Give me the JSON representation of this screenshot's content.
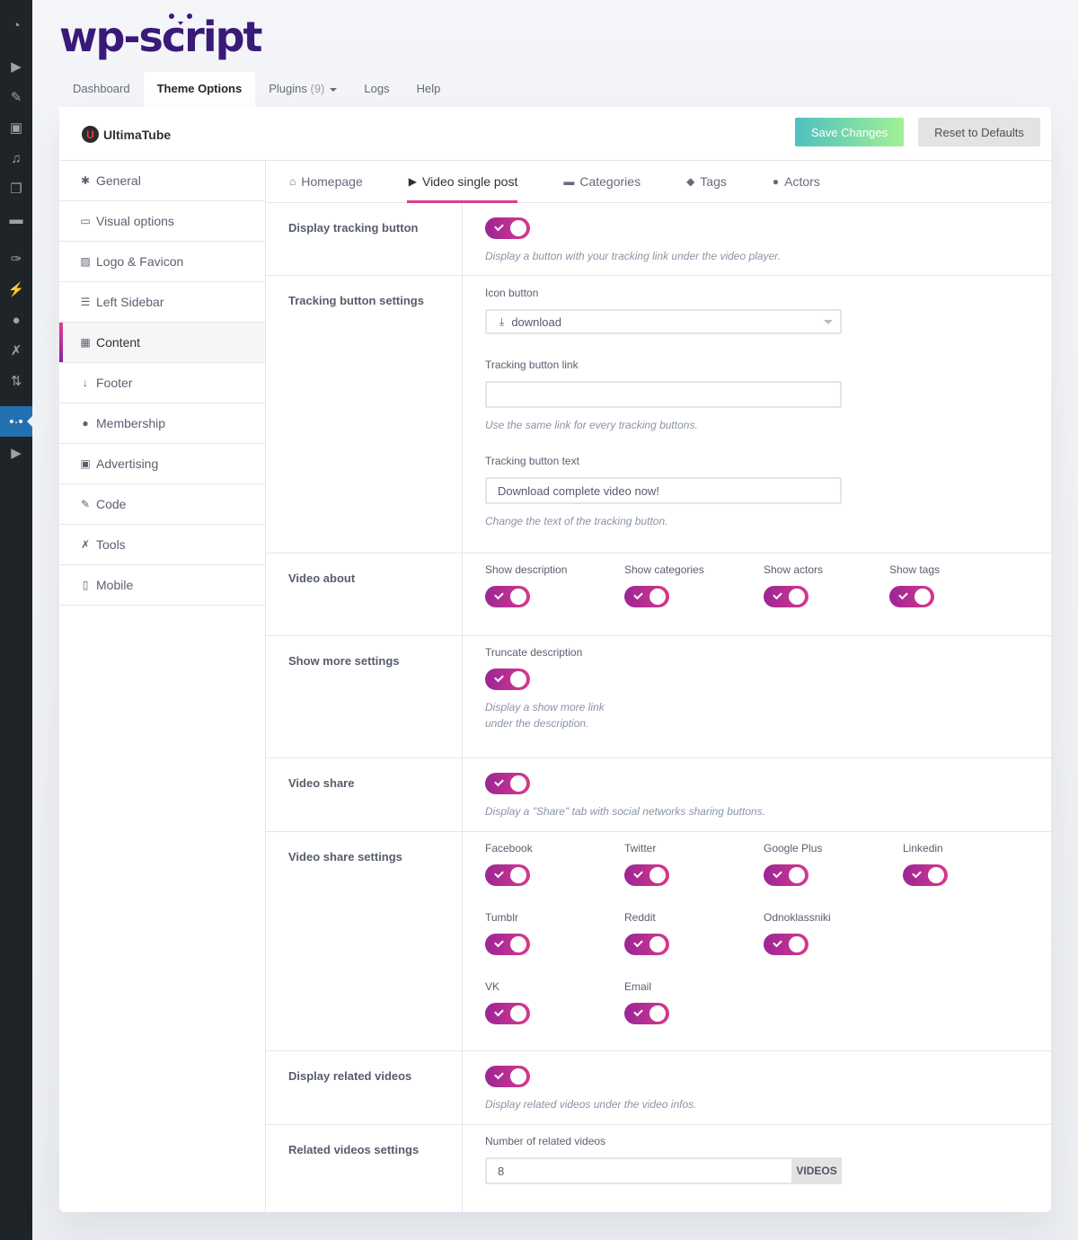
{
  "wp_sidebar": {
    "items": [
      {
        "name": "dashboard-icon",
        "glyph": "◔"
      },
      {
        "name": "media-play-icon",
        "glyph": "▶"
      },
      {
        "name": "pin-icon",
        "glyph": "✎"
      },
      {
        "name": "gallery-icon",
        "glyph": "▣"
      },
      {
        "name": "media-icon",
        "glyph": "♫"
      },
      {
        "name": "pages-icon",
        "glyph": "❐"
      },
      {
        "name": "comments-icon",
        "glyph": "▬"
      },
      {
        "name": "appearance-icon",
        "glyph": "✑"
      },
      {
        "name": "plugins-icon",
        "glyph": "⚡"
      },
      {
        "name": "users-icon",
        "glyph": "●"
      },
      {
        "name": "tools-icon",
        "glyph": "✗"
      },
      {
        "name": "settings-icon",
        "glyph": "⇅"
      },
      {
        "name": "wp-script-icon",
        "glyph": "•·•"
      },
      {
        "name": "video-icon",
        "glyph": "▶"
      }
    ]
  },
  "logo": {
    "text": "wp-script"
  },
  "topnav": {
    "tabs": [
      {
        "label": "Dashboard"
      },
      {
        "label": "Theme Options"
      },
      {
        "label": "Plugins",
        "count": "(9)"
      },
      {
        "label": "Logs"
      },
      {
        "label": "Help"
      }
    ]
  },
  "panel": {
    "brand_letter": "U",
    "brand_name": "UltimaTube",
    "save_label": "Save Changes",
    "reset_label": "Reset to Defaults"
  },
  "sidenav": {
    "items": [
      {
        "label": "General",
        "glyph": "✱"
      },
      {
        "label": "Visual options",
        "glyph": "▭"
      },
      {
        "label": "Logo & Favicon",
        "glyph": "▨"
      },
      {
        "label": "Left Sidebar",
        "glyph": "☰"
      },
      {
        "label": "Content",
        "glyph": "▦"
      },
      {
        "label": "Footer",
        "glyph": "↓"
      },
      {
        "label": "Membership",
        "glyph": "●"
      },
      {
        "label": "Advertising",
        "glyph": "▣"
      },
      {
        "label": "Code",
        "glyph": "✎"
      },
      {
        "label": "Tools",
        "glyph": "✗"
      },
      {
        "label": "Mobile",
        "glyph": "▯"
      }
    ]
  },
  "subtabs": [
    {
      "label": "Homepage",
      "glyph": "⌂"
    },
    {
      "label": "Video single post",
      "glyph": "▶"
    },
    {
      "label": "Categories",
      "glyph": "▬"
    },
    {
      "label": "Tags",
      "glyph": "◆"
    },
    {
      "label": "Actors",
      "glyph": "●"
    }
  ],
  "sections": {
    "tracking": {
      "label": "Display tracking button",
      "enabled": true,
      "help": "Display a button with your tracking link under the video player."
    },
    "tracking_settings": {
      "label": "Tracking button settings",
      "icon_label": "Icon button",
      "icon_value": "download",
      "icon_glyph": "⤓",
      "link_label": "Tracking button link",
      "link_value": "",
      "link_help": "Use the same link for every tracking buttons.",
      "text_label": "Tracking button text",
      "text_value": "Download complete video now!",
      "text_help": "Change the text of the tracking button."
    },
    "video_about": {
      "label": "Video about",
      "options": [
        {
          "label": "Show description",
          "enabled": true
        },
        {
          "label": "Show categories",
          "enabled": true
        },
        {
          "label": "Show actors",
          "enabled": true
        },
        {
          "label": "Show tags",
          "enabled": true
        }
      ]
    },
    "show_more": {
      "label": "Show more settings",
      "option_label": "Truncate description",
      "enabled": true,
      "help_line1": "Display a show more link",
      "help_line2": "under the description."
    },
    "video_share": {
      "label": "Video share",
      "enabled": true,
      "help": "Display a \"Share\" tab with social networks sharing buttons."
    },
    "share_settings": {
      "label": "Video share settings",
      "networks": [
        {
          "label": "Facebook",
          "enabled": true
        },
        {
          "label": "Twitter",
          "enabled": true
        },
        {
          "label": "Google Plus",
          "enabled": true
        },
        {
          "label": "Linkedin",
          "enabled": true
        },
        {
          "label": "Tumblr",
          "enabled": true
        },
        {
          "label": "Reddit",
          "enabled": true
        },
        {
          "label": "Odnoklassniki",
          "enabled": true
        },
        {
          "label": "VK",
          "enabled": true
        },
        {
          "label": "Email",
          "enabled": true
        }
      ]
    },
    "related": {
      "label": "Display related videos",
      "enabled": true,
      "help": "Display related videos under the video infos."
    },
    "related_settings": {
      "label": "Related videos settings",
      "field_label": "Number of related videos",
      "value": "8",
      "suffix": "VIDEOS"
    }
  }
}
